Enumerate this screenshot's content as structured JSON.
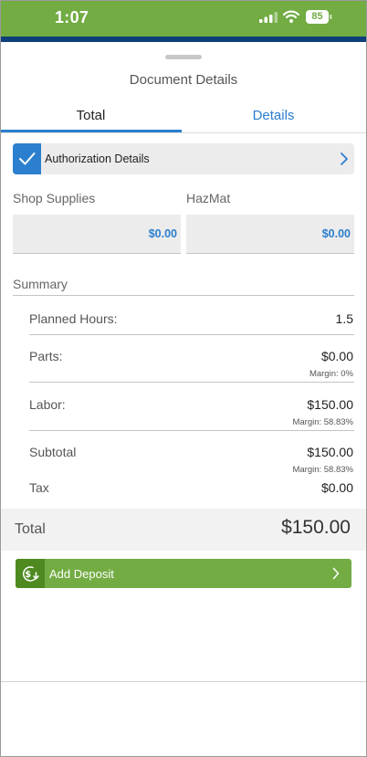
{
  "status_bar": {
    "time": "1:07",
    "battery": "85"
  },
  "header": {
    "title": "Document Details"
  },
  "tabs": [
    {
      "label": "Total"
    },
    {
      "label": "Details"
    }
  ],
  "authorization": {
    "label": "Authorization Details"
  },
  "fields": {
    "shop_supplies": {
      "label": "Shop Supplies",
      "value": "$0.00"
    },
    "hazmat": {
      "label": "HazMat",
      "value": "$0.00"
    }
  },
  "summary": {
    "label": "Summary",
    "planned_hours": {
      "label": "Planned Hours:",
      "value": "1.5"
    },
    "parts": {
      "label": "Parts:",
      "value": "$0.00",
      "margin": "Margin: 0%"
    },
    "labor": {
      "label": "Labor:",
      "value": "$150.00",
      "margin": "Margin: 58.83%"
    },
    "subtotal": {
      "label": "Subtotal",
      "value": "$150.00",
      "margin": "Margin: 58.83%"
    },
    "tax": {
      "label": "Tax",
      "value": "$0.00"
    }
  },
  "total": {
    "label": "Total",
    "value": "$150.00"
  },
  "deposit": {
    "label": "Add Deposit"
  },
  "colors": {
    "brand_green": "#72ac43",
    "dark_green": "#4e8a1f",
    "accent_blue": "#2b7fce",
    "navy": "#0e3f78"
  }
}
